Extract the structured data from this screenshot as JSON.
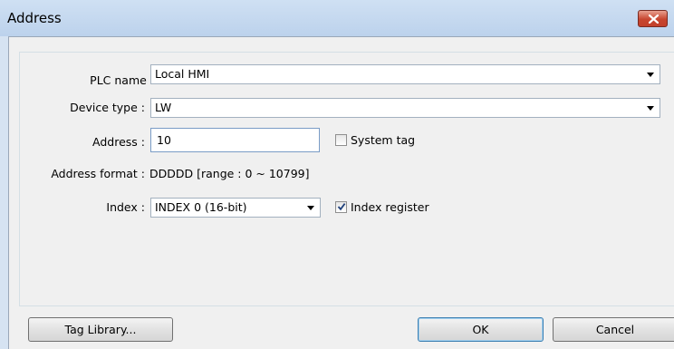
{
  "window": {
    "title": "Address"
  },
  "form": {
    "plc_name_label": "PLC name :",
    "plc_name_value": "Local HMI",
    "device_type_label": "Device type :",
    "device_type_value": "LW",
    "address_label": "Address :",
    "address_value": "10",
    "system_tag_label": "System tag",
    "system_tag_checked": false,
    "address_format_label": "Address format :",
    "address_format_value": "DDDDD [range : 0 ~ 10799]",
    "index_label": "Index :",
    "index_value": "INDEX 0 (16-bit)",
    "index_register_label": "Index register",
    "index_register_checked": true
  },
  "buttons": {
    "tag_library": "Tag Library...",
    "ok": "OK",
    "cancel": "Cancel"
  },
  "icons": {
    "close": "close-icon",
    "dropdown": "chevron-down-icon",
    "check": "checkmark-icon"
  }
}
